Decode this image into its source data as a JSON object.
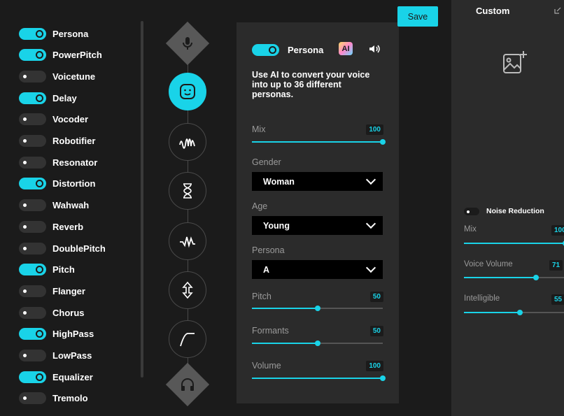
{
  "effects": [
    {
      "label": "Persona",
      "on": true
    },
    {
      "label": "PowerPitch",
      "on": true
    },
    {
      "label": "Voicetune",
      "on": false
    },
    {
      "label": "Delay",
      "on": true
    },
    {
      "label": "Vocoder",
      "on": false
    },
    {
      "label": "Robotifier",
      "on": false
    },
    {
      "label": "Resonator",
      "on": false
    },
    {
      "label": "Distortion",
      "on": true
    },
    {
      "label": "Wahwah",
      "on": false
    },
    {
      "label": "Reverb",
      "on": false
    },
    {
      "label": "DoublePitch",
      "on": false
    },
    {
      "label": "Pitch",
      "on": true
    },
    {
      "label": "Flanger",
      "on": false
    },
    {
      "label": "Chorus",
      "on": false
    },
    {
      "label": "HighPass",
      "on": true
    },
    {
      "label": "LowPass",
      "on": false
    },
    {
      "label": "Equalizer",
      "on": true
    },
    {
      "label": "Tremolo",
      "on": false
    }
  ],
  "chain": [
    {
      "icon": "microphone-icon",
      "kind": "diamond"
    },
    {
      "icon": "face-icon",
      "kind": "active"
    },
    {
      "icon": "waveform-icon",
      "kind": "node"
    },
    {
      "icon": "hourglass-icon",
      "kind": "node"
    },
    {
      "icon": "pulse-wave-icon",
      "kind": "node"
    },
    {
      "icon": "pitch-arrows-icon",
      "kind": "node"
    },
    {
      "icon": "curve-icon",
      "kind": "node"
    },
    {
      "icon": "headphones-icon",
      "kind": "diamond"
    }
  ],
  "save_label": "Save",
  "panel": {
    "title": "Persona",
    "ai_badge": "AI",
    "description": "Use AI to convert your voice into up to 36 different personas.",
    "mix": {
      "label": "Mix",
      "value": 100
    },
    "gender": {
      "label": "Gender",
      "selected": "Woman"
    },
    "age": {
      "label": "Age",
      "selected": "Young"
    },
    "persona": {
      "label": "Persona",
      "selected": "A"
    },
    "pitch": {
      "label": "Pitch",
      "value": 50
    },
    "formants": {
      "label": "Formants",
      "value": 50
    },
    "volume": {
      "label": "Volume",
      "value": 100
    }
  },
  "right": {
    "title": "Custom",
    "noise_reduction": {
      "label": "Noise Reduction",
      "on": false
    },
    "mix": {
      "label": "Mix",
      "value": 100
    },
    "voice_volume": {
      "label": "Voice Volume",
      "value": 71
    },
    "intelligible": {
      "label": "Intelligible",
      "value": 55
    }
  },
  "colors": {
    "accent": "#19d3e8",
    "bg": "#1b1b1b",
    "panel": "#2b2b2b"
  }
}
